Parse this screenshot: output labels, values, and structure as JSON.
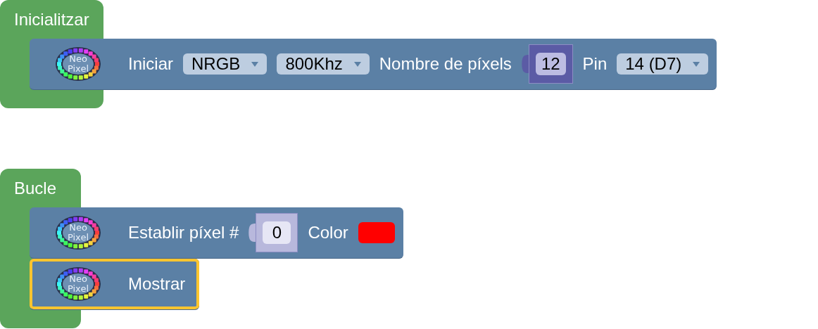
{
  "blocks": [
    {
      "kind": "event",
      "label": "Inicialitzar",
      "statements": [
        {
          "kind": "statement",
          "selected": false,
          "logo": [
            "Neo",
            "Pixel"
          ],
          "inputs": [
            {
              "kind": "label",
              "text": "Iniciar"
            },
            {
              "kind": "dropdown",
              "value": "NRGB"
            },
            {
              "kind": "dropdown",
              "value": "800Khz"
            },
            {
              "kind": "label",
              "text": "Nombre de píxels"
            },
            {
              "kind": "number",
              "value": "12",
              "shadow": false
            },
            {
              "kind": "label",
              "text": "Pin"
            },
            {
              "kind": "dropdown",
              "value": "14 (D7)"
            }
          ]
        }
      ]
    },
    {
      "kind": "event",
      "label": "Bucle",
      "statements": [
        {
          "kind": "statement",
          "selected": false,
          "logo": [
            "Neo",
            "Pixel"
          ],
          "inputs": [
            {
              "kind": "label",
              "text": "Establir píxel #"
            },
            {
              "kind": "number",
              "value": "0",
              "shadow": true
            },
            {
              "kind": "label",
              "text": "Color"
            },
            {
              "kind": "color",
              "color": "#ff0000"
            }
          ]
        },
        {
          "kind": "statement",
          "selected": true,
          "logo": [
            "Neo",
            "Pixel"
          ],
          "inputs": [
            {
              "kind": "label",
              "text": "Mostrar"
            }
          ]
        }
      ]
    }
  ]
}
